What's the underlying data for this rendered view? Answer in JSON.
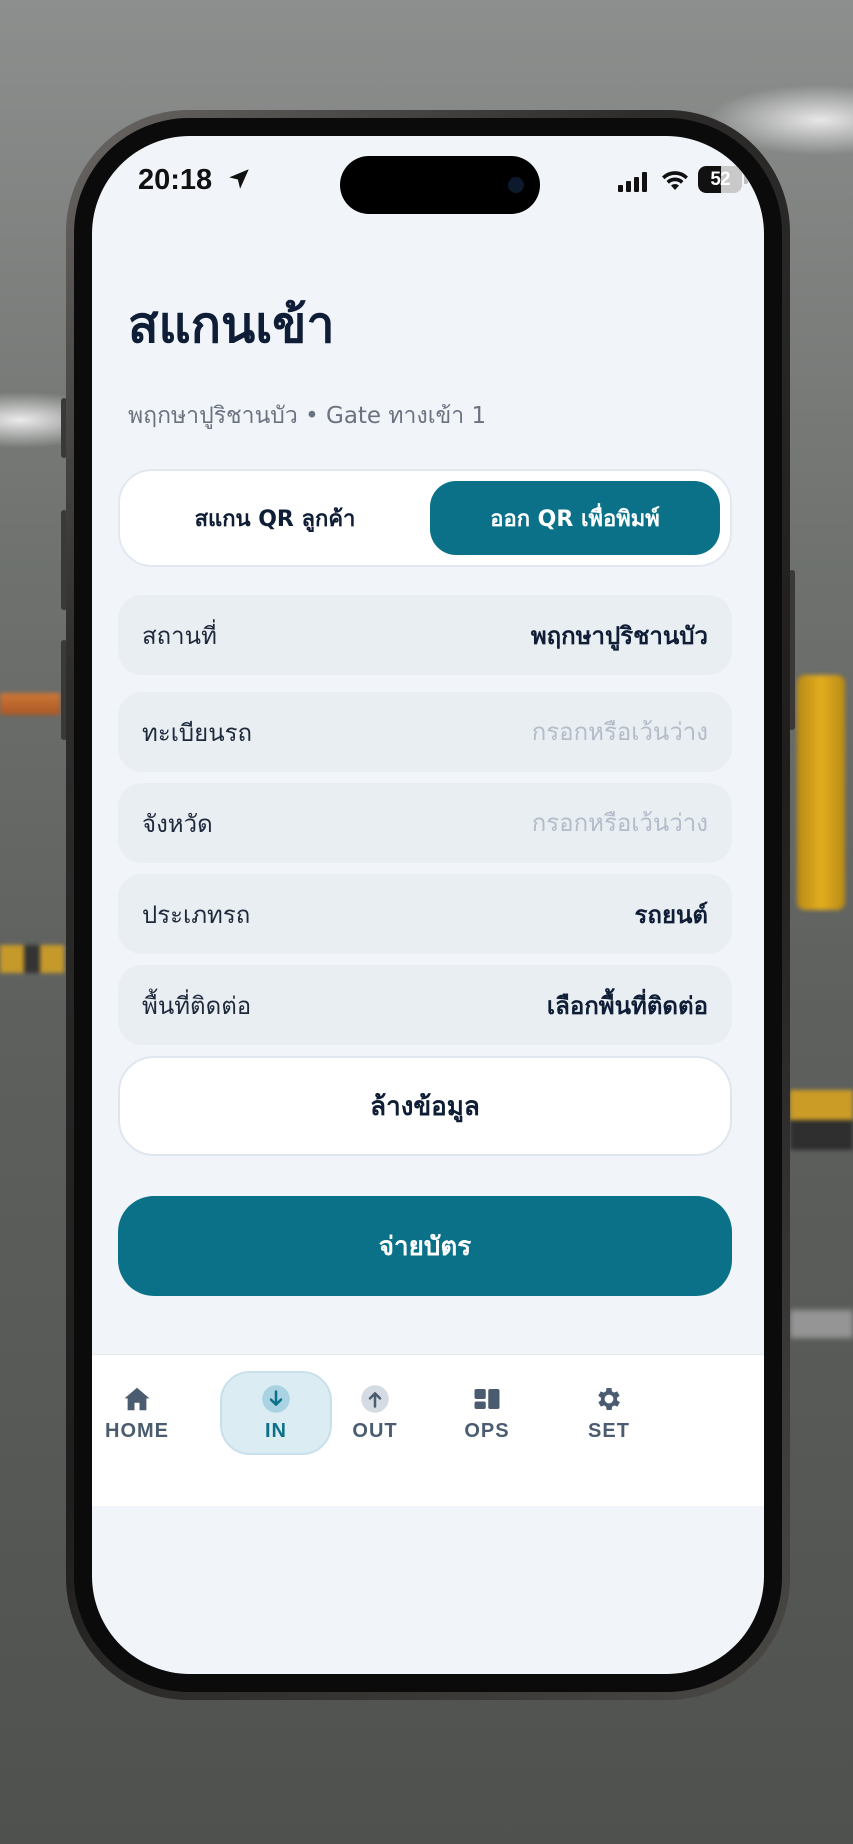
{
  "status_bar": {
    "time": "20:18",
    "battery": "52",
    "battery_level": 0.52
  },
  "header": {
    "title": "สแกนเข้า",
    "subtitle": "พฤกษาปูริชานบัว • Gate ทางเข้า 1"
  },
  "mode_toggle": {
    "options": [
      "สแกน QR ลูกค้า",
      "ออก QR เพื่อพิมพ์"
    ],
    "active_index": 1
  },
  "form": {
    "location": {
      "label": "สถานที่",
      "value": "พฤกษาปูริชานบัว"
    },
    "plate": {
      "label": "ทะเบียนรถ",
      "value": "",
      "placeholder": "กรอกหรือเว้นว่าง"
    },
    "province": {
      "label": "จังหวัด",
      "value": "",
      "placeholder": "กรอกหรือเว้นว่าง"
    },
    "vehicle_type": {
      "label": "ประเภทรถ",
      "value": "รถยนต์"
    },
    "contact_area": {
      "label": "พื้นที่ติดต่อ",
      "value": "เลือกพื้นที่ติดต่อ"
    }
  },
  "actions": {
    "clear_label": "ล้างข้อมูล",
    "issue_label": "จ่ายบัตร"
  },
  "nav": {
    "items": [
      {
        "label": "HOME",
        "icon": "home-icon"
      },
      {
        "label": "IN",
        "icon": "arrow-down-circle-icon"
      },
      {
        "label": "OUT",
        "icon": "arrow-up-circle-icon"
      },
      {
        "label": "OPS",
        "icon": "dashboard-icon"
      },
      {
        "label": "SET",
        "icon": "gear-icon"
      }
    ],
    "active_index": 1
  },
  "colors": {
    "accent": "#0a7189",
    "text_primary": "#0f1e36",
    "screen_bg": "#f1f5f9",
    "field_bg": "#e9eef3"
  }
}
